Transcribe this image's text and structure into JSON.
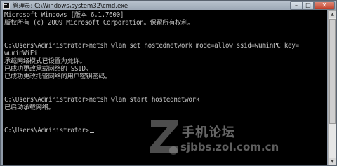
{
  "window": {
    "title": "管理员: C:\\Windows\\system32\\cmd.exe",
    "controls": {
      "minimize": "–",
      "maximize": "□",
      "close": "✕"
    }
  },
  "console": {
    "lines": [
      "Microsoft Windows [版本 6.1.7600]",
      "版权所有 (c) 2009 Microsoft Corporation。保留所有权利。",
      "",
      "C:\\Users\\Administrator>netsh wlan set hostednetwork mode=allow ssid=wuminPC key=",
      "wuminWiFi",
      "承载网络模式已设置为允许。",
      "已成功更改承载网络的 SSID。",
      "已成功更改托管网络的用户密钥密码。",
      "",
      "",
      "C:\\Users\\Administrator>netsh wlan start hostednetwork",
      "已启动承载网络。",
      "",
      "",
      "C:\\Users\\Administrator>"
    ]
  },
  "watermark": {
    "brand": "手机论坛",
    "url": "sjbbs.zol.com.cn"
  },
  "icons": {
    "app": "console-icon",
    "watermark": "zol-logo-icon"
  }
}
